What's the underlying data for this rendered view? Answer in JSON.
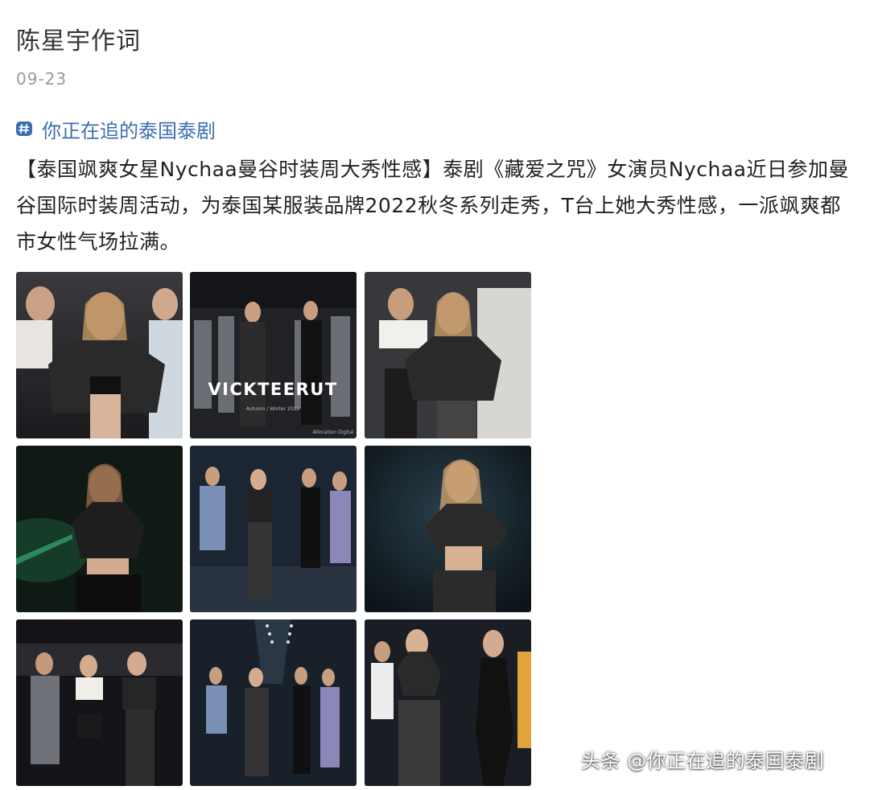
{
  "post": {
    "author": "陈星宇作词",
    "date": "09-23",
    "topic": {
      "label": "你正在追的泰国泰剧",
      "icon": "hashtag-icon"
    },
    "text": "【泰国飒爽女星Nychaa曼谷时装周大秀性感】泰剧《藏爱之咒》女演员Nychaa近日参加曼谷国际时装周活动，为泰国某服装品牌2022秋冬系列走秀，T台上她大秀性感，一派飒爽都市女性气场拉满。"
  },
  "images": {
    "brand_overlay": "VICKTEERUT",
    "overlay_small": "Autumn / Winter 2022",
    "overlay_credit": "Allocation Digital"
  },
  "watermark": "头条 @你正在追的泰国泰剧",
  "colors": {
    "topic": "#3d6fb0",
    "date": "#9a9a9a"
  }
}
